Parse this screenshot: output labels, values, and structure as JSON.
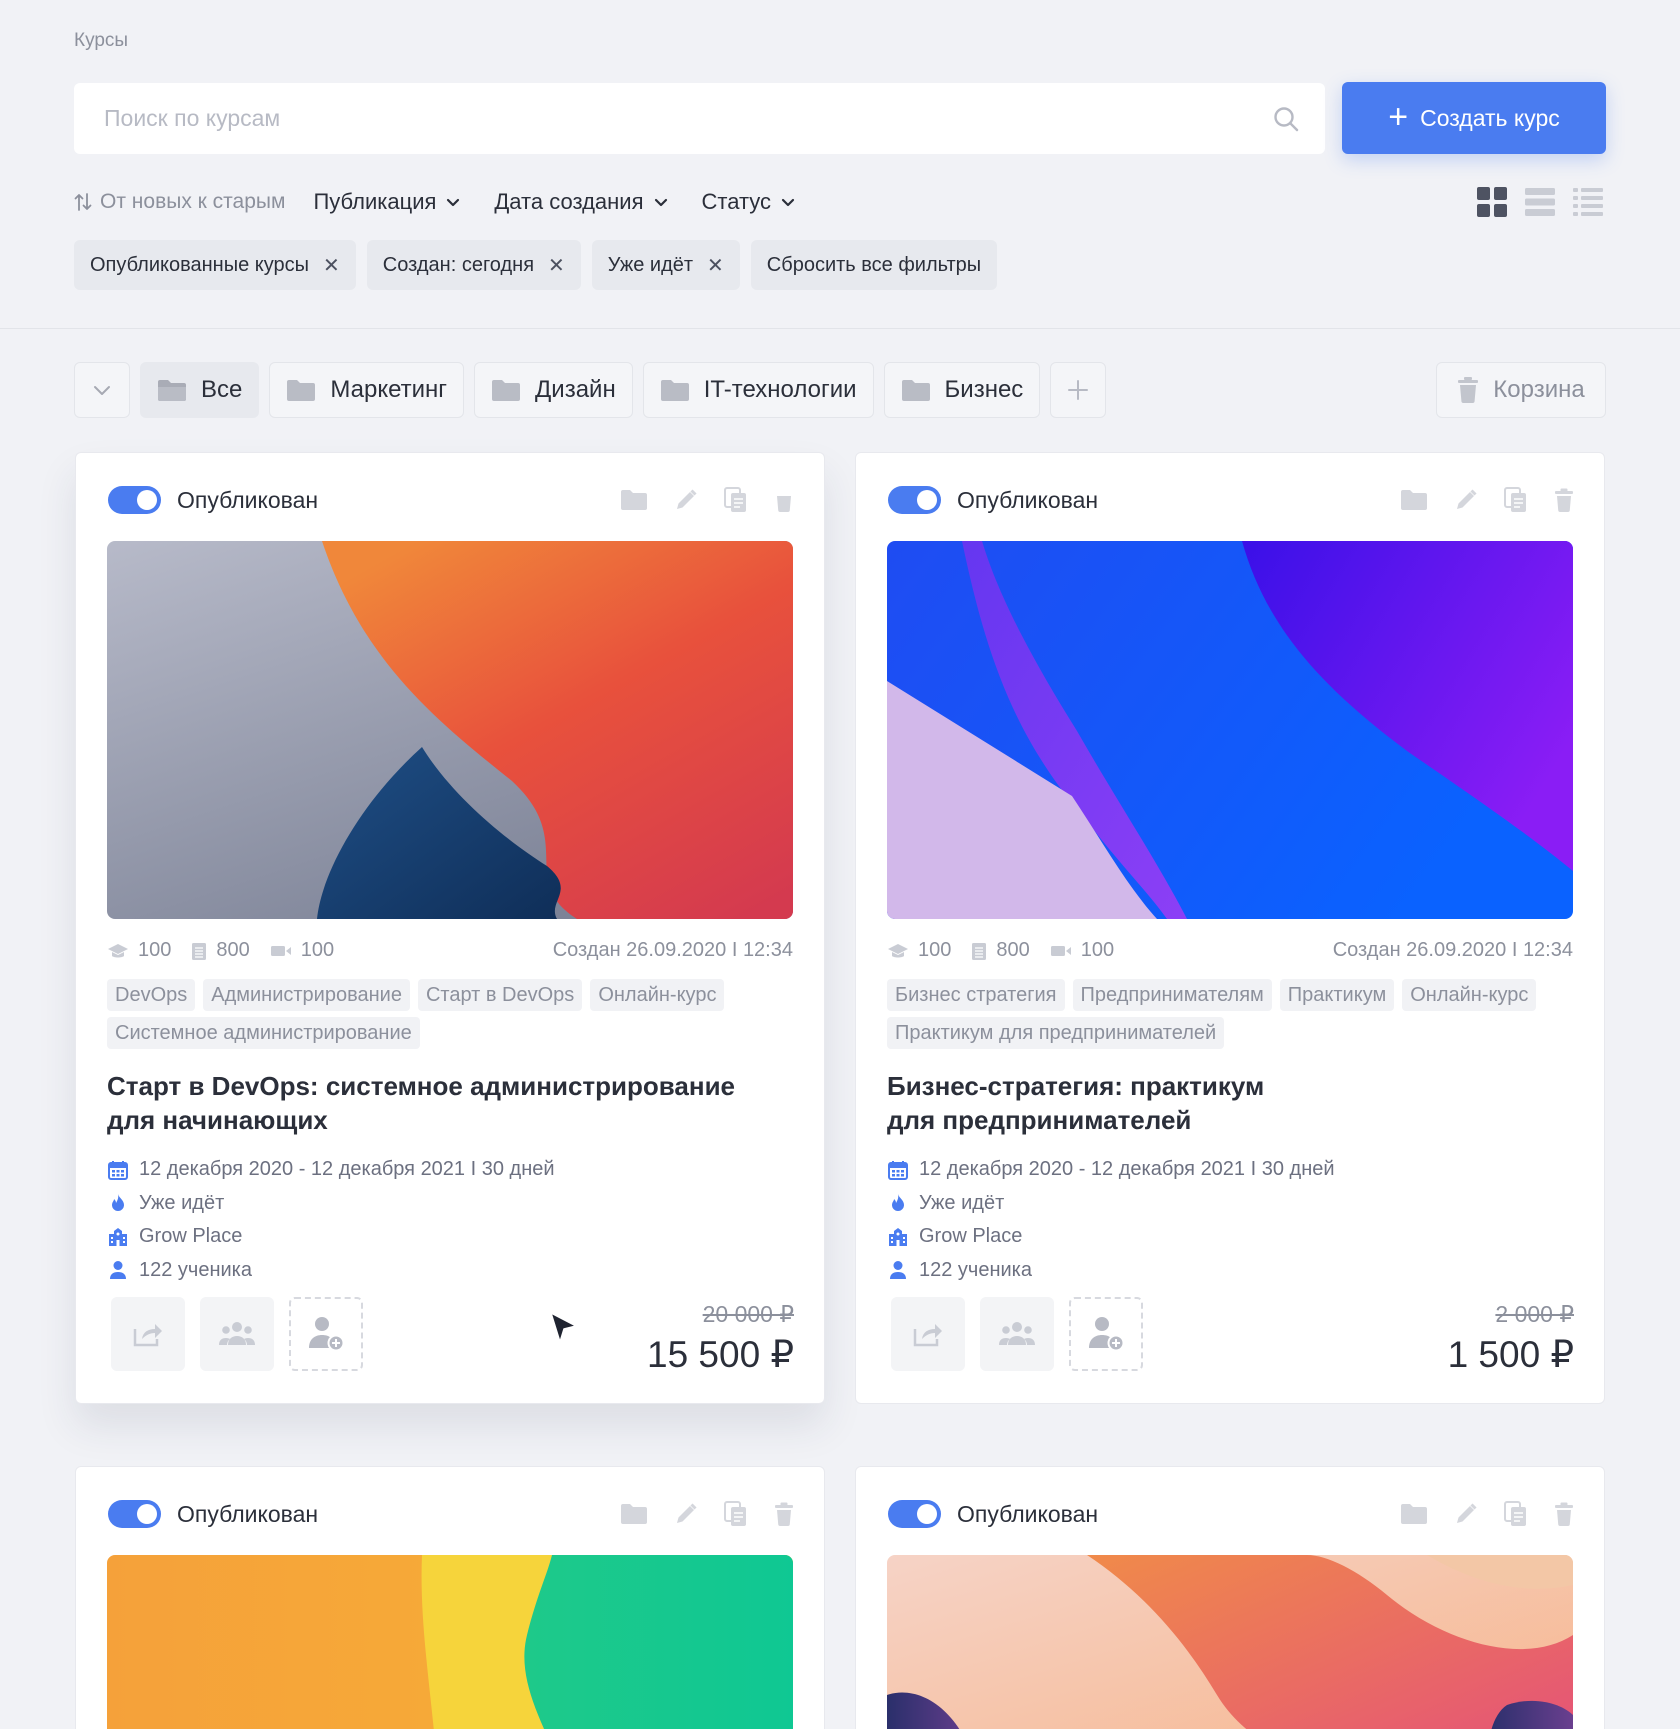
{
  "breadcrumb": "Курсы",
  "search": {
    "placeholder": "Поиск по курсам"
  },
  "create_button": {
    "label": "Создать курс",
    "color": "#4a7cf0"
  },
  "sort": {
    "label": "От новых к старым"
  },
  "dropdowns": [
    "Публикация",
    "Дата создания",
    "Статус"
  ],
  "view_modes": [
    "grid",
    "list",
    "compact-list"
  ],
  "active_filters": [
    {
      "label": "Опубликованные курсы",
      "removable": true
    },
    {
      "label": "Создан: сегодня",
      "removable": true
    },
    {
      "label": "Уже идёт",
      "removable": true
    },
    {
      "label": "Сбросить все фильтры",
      "removable": false
    }
  ],
  "folders": [
    "Все",
    "Маркетинг",
    "Дизайн",
    "IT-технологии",
    "Бизнес"
  ],
  "trash_label": "Корзина",
  "cards": [
    {
      "status": "Опубликован",
      "stats": {
        "students": "100",
        "lessons": "800",
        "videos": "100"
      },
      "created": "Создан 26.09.2020 I 12:34",
      "tags": [
        "DevOps",
        "Администрирование",
        "Старт в DevOps",
        "Онлайн-курс",
        "Системное администрирование"
      ],
      "title_line1": "Старт в DevOps: системное администрирование",
      "title_line2": "для начинающих",
      "dates": "12 декабря 2020 - 12 декабря 2021  I  30 дней",
      "state": "Уже идёт",
      "school": "Grow Place",
      "learners": "122 ученика",
      "old_price": "20 000 ₽",
      "price": "15 500 ₽"
    },
    {
      "status": "Опубликован",
      "stats": {
        "students": "100",
        "lessons": "800",
        "videos": "100"
      },
      "created": "Создан 26.09.2020 I 12:34",
      "tags": [
        "Бизнес стратегия",
        "Предпринимателям",
        "Практикум",
        "Онлайн-курс",
        "Практикум для предпринимателей"
      ],
      "title_line1": "Бизнес-стратегия: практикум",
      "title_line2": "для предпринимателей",
      "dates": "12 декабря 2020 - 12 декабря 2021  I  30 дней",
      "state": "Уже идёт",
      "school": "Grow Place",
      "learners": "122 ученика",
      "old_price": "2 000 ₽",
      "price": "1 500 ₽"
    },
    {
      "status": "Опубликован"
    },
    {
      "status": "Опубликован"
    }
  ]
}
